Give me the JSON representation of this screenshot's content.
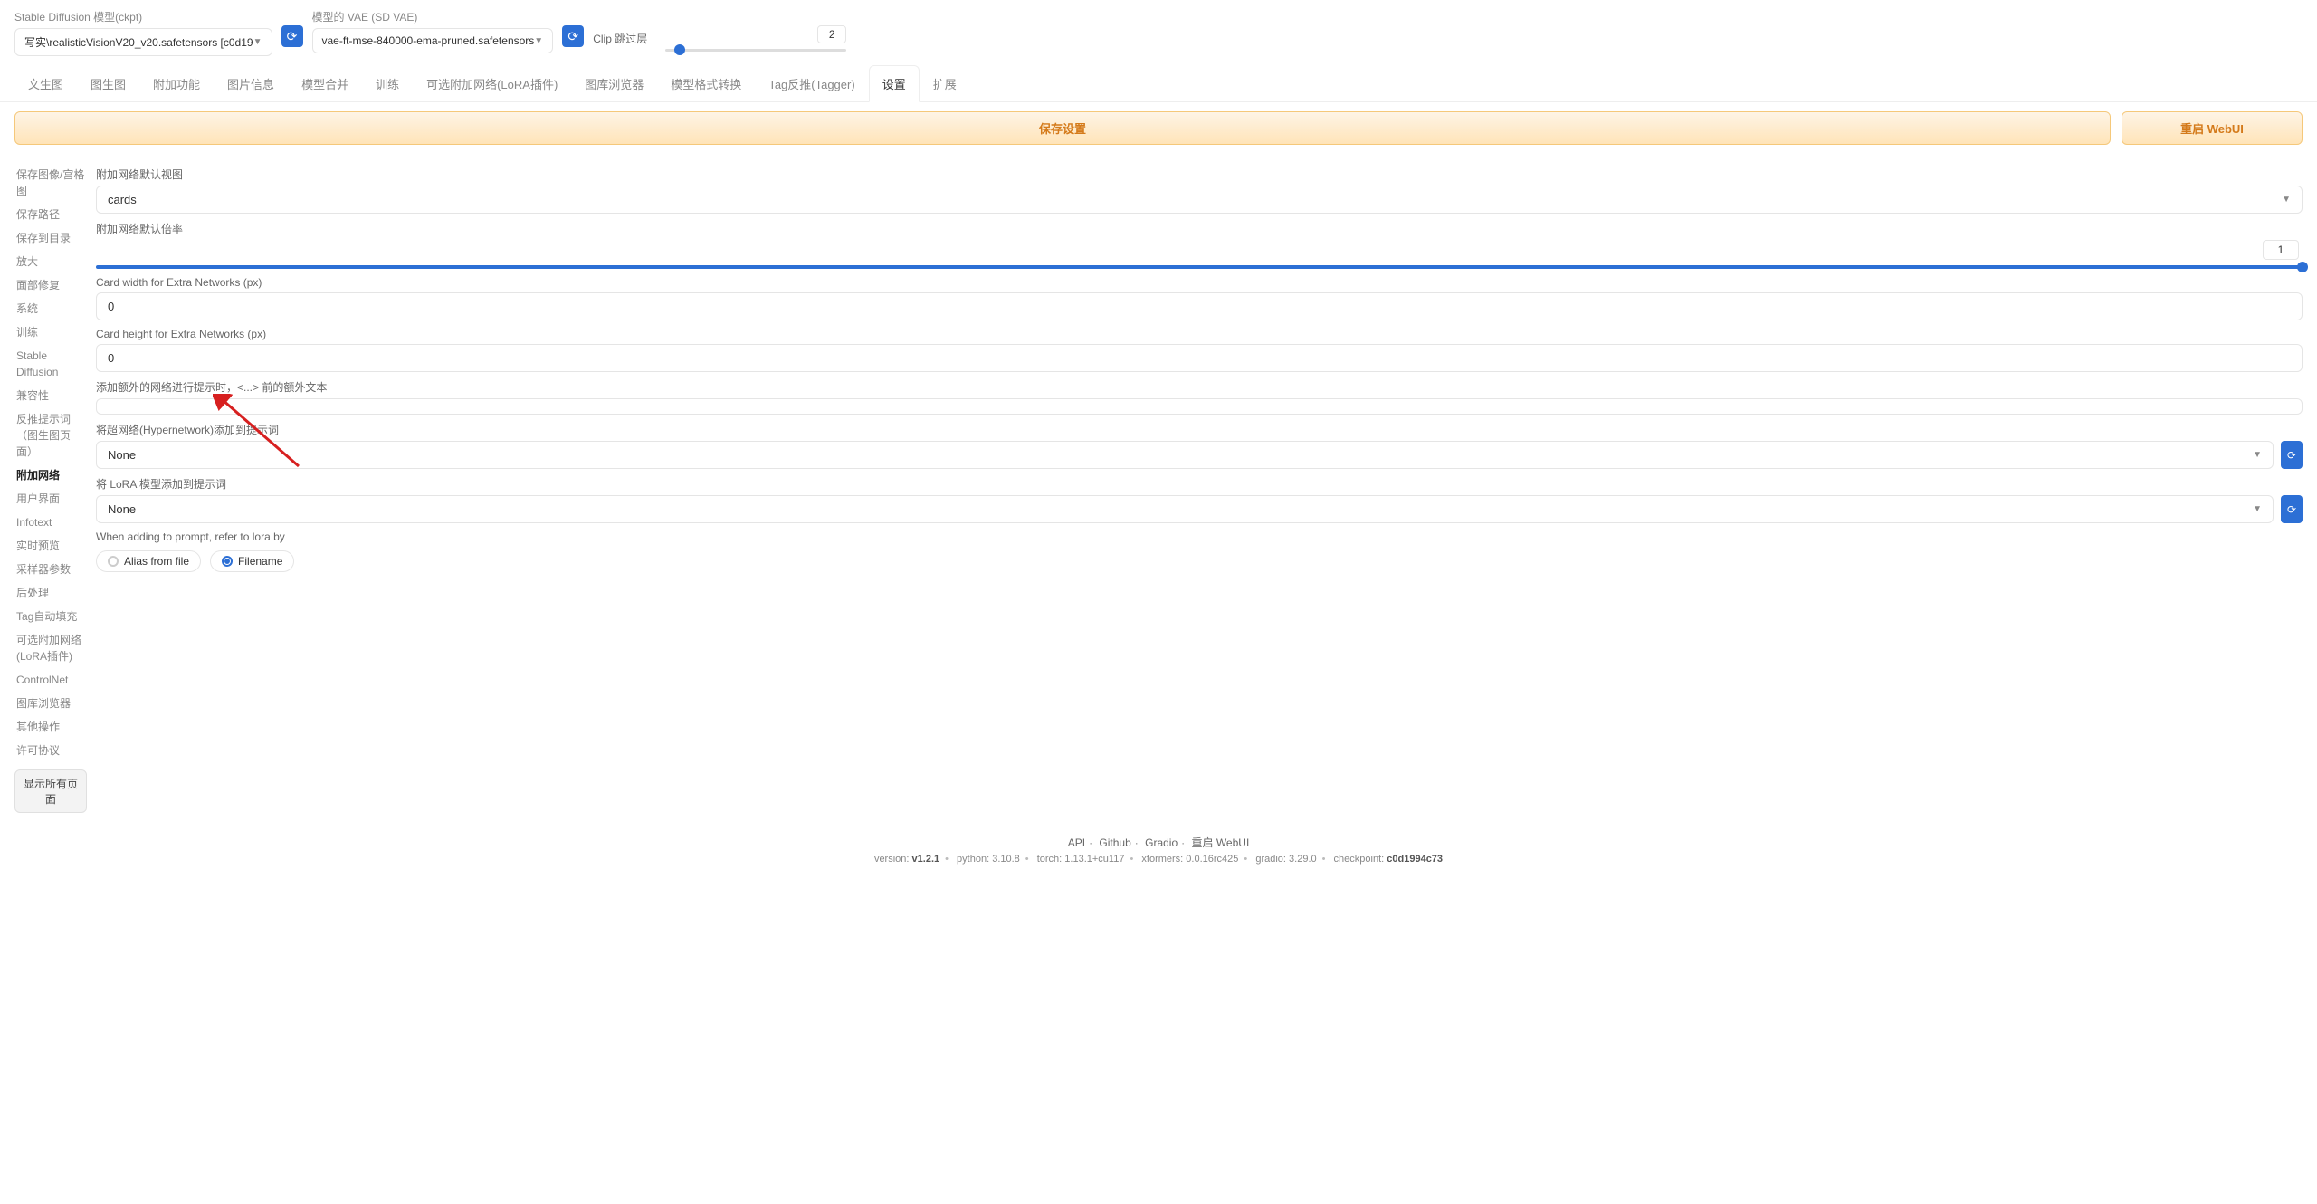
{
  "header": {
    "checkpoint_label": "Stable Diffusion 模型(ckpt)",
    "checkpoint_value": "写实\\realisticVisionV20_v20.safetensors [c0d19",
    "vae_label": "模型的 VAE (SD VAE)",
    "vae_value": "vae-ft-mse-840000-ema-pruned.safetensors",
    "clip_label": "Clip 跳过层",
    "clip_value": "2"
  },
  "tabs": [
    "文生图",
    "图生图",
    "附加功能",
    "图片信息",
    "模型合并",
    "训练",
    "可选附加网络(LoRA插件)",
    "图库浏览器",
    "模型格式转换",
    "Tag反推(Tagger)",
    "设置",
    "扩展"
  ],
  "active_tab": "设置",
  "buttons": {
    "save": "保存设置",
    "restart": "重启 WebUI"
  },
  "sidebar": {
    "items": [
      "保存图像/宫格图",
      "保存路径",
      "保存到目录",
      "放大",
      "面部修复",
      "系统",
      "训练",
      "Stable Diffusion",
      "兼容性",
      "反推提示词（图生图页面）",
      "附加网络",
      "用户界面",
      "Infotext",
      "实时预览",
      "采样器参数",
      "后处理",
      "Tag自动填充",
      "可选附加网络(LoRA插件)",
      "ControlNet",
      "图库浏览器",
      "其他操作",
      "许可协议"
    ],
    "active": "附加网络",
    "show_all": "显示所有页面"
  },
  "fields": {
    "default_view_label": "附加网络默认视图",
    "default_view_value": "cards",
    "default_mult_label": "附加网络默认倍率",
    "default_mult_value": "1",
    "card_width_label": "Card width for Extra Networks (px)",
    "card_width_value": "0",
    "card_height_label": "Card height for Extra Networks (px)",
    "card_height_value": "0",
    "extra_text_label": "添加额外的网络进行提示时，<...> 前的额外文本",
    "extra_text_value": "",
    "hypernet_label": "将超网络(Hypernetwork)添加到提示词",
    "hypernet_value": "None",
    "lora_label": "将 LoRA 模型添加到提示词",
    "lora_value": "None",
    "lora_ref_label": "When adding to prompt, refer to lora by",
    "radio_alias": "Alias from file",
    "radio_filename": "Filename"
  },
  "footer": {
    "links": [
      "API",
      "Github",
      "Gradio",
      "重启 WebUI"
    ],
    "meta": {
      "version_label": "version:",
      "version": "v1.2.1",
      "python_label": "python:",
      "python": "3.10.8",
      "torch_label": "torch:",
      "torch": "1.13.1+cu117",
      "xformers_label": "xformers:",
      "xformers": "0.0.16rc425",
      "gradio_label": "gradio:",
      "gradio": "3.29.0",
      "checkpoint_label": "checkpoint:",
      "checkpoint": "c0d1994c73"
    }
  }
}
